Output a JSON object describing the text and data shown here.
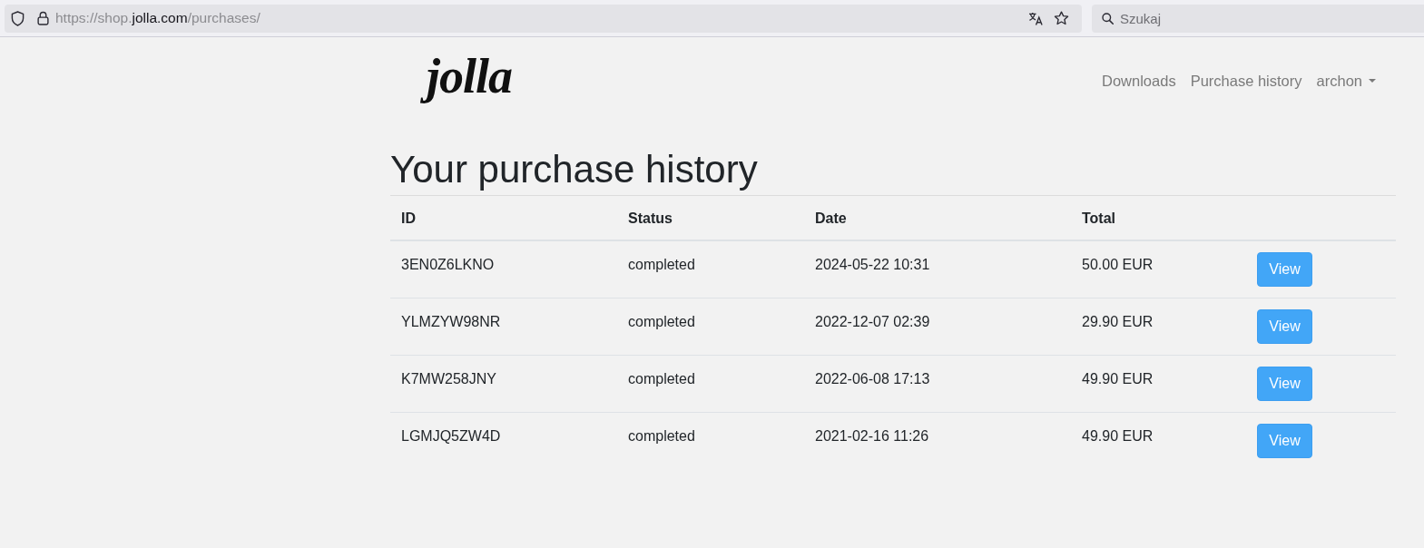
{
  "browser": {
    "address_bar": {
      "url_parts": [
        {
          "text": "https://shop.",
          "emphasis": false
        },
        {
          "text": "jolla.com",
          "emphasis": true
        },
        {
          "text": "/purchases/",
          "emphasis": false
        }
      ]
    },
    "search": {
      "placeholder": "Szukaj"
    }
  },
  "header": {
    "logo": "jolla",
    "nav": [
      {
        "label": "Downloads",
        "kind": "link"
      },
      {
        "label": "Purchase history",
        "kind": "link"
      },
      {
        "label": "archon",
        "kind": "dropdown"
      }
    ]
  },
  "page": {
    "title": "Your purchase history"
  },
  "table": {
    "columns": [
      "ID",
      "Status",
      "Date",
      "Total"
    ],
    "rows": [
      {
        "id": "3EN0Z6LKNO",
        "status": "completed",
        "date": "2024-05-22 10:31",
        "total": "50.00 EUR",
        "action": "View"
      },
      {
        "id": "YLMZYW98NR",
        "status": "completed",
        "date": "2022-12-07 02:39",
        "total": "29.90 EUR",
        "action": "View"
      },
      {
        "id": "K7MW258JNY",
        "status": "completed",
        "date": "2022-06-08 17:13",
        "total": "49.90 EUR",
        "action": "View"
      },
      {
        "id": "LGMJQ5ZW4D",
        "status": "completed",
        "date": "2021-02-16 11:26",
        "total": "49.90 EUR",
        "action": "View"
      }
    ]
  }
}
